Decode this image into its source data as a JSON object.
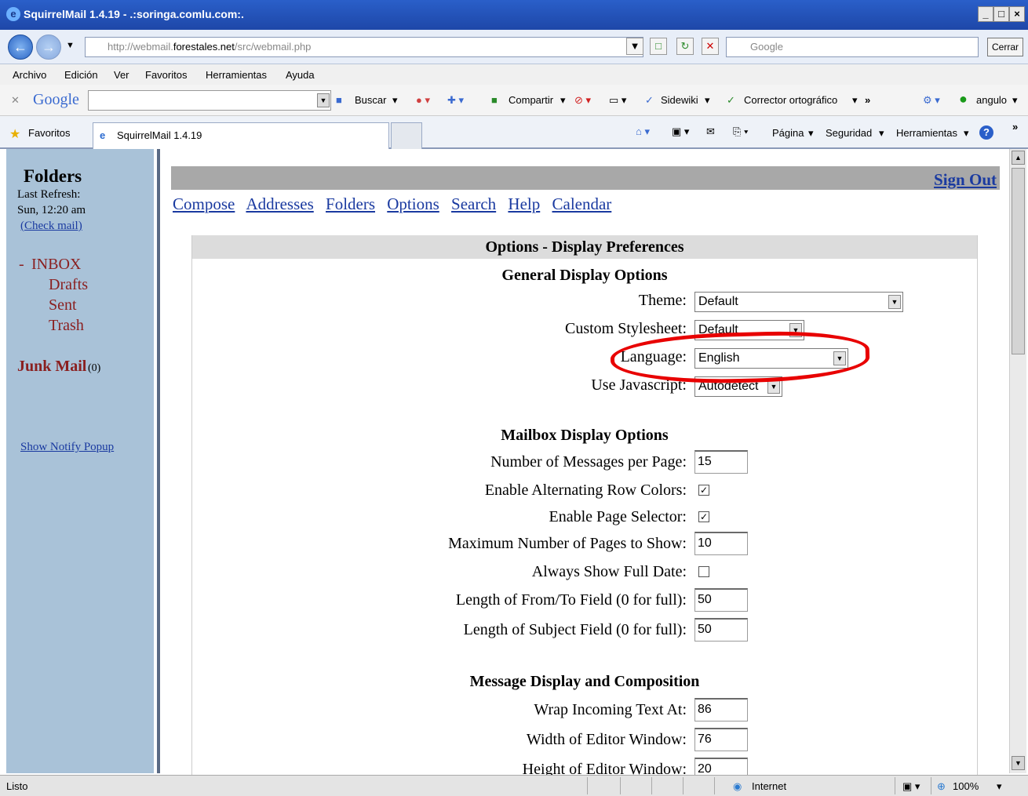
{
  "window": {
    "title": "SquirrelMail 1.4.19 - .:soringa.comlu.com:.",
    "minimize": "_",
    "maximize": "×"
  },
  "addressbar": {
    "url_prefix": "http://webmail.",
    "url_domain": "forestales.net",
    "url_path": "/src/webmail.php",
    "search_placeholder": "Google",
    "close_label": "Cerrar"
  },
  "menubar": {
    "items": [
      "Archivo",
      "Edición",
      "Ver",
      "Favoritos",
      "Herramientas",
      "Ayuda"
    ]
  },
  "google_toolbar": {
    "logo": "Google",
    "buscar": "Buscar",
    "compartir": "Compartir",
    "sidewiki": "Sidewiki",
    "corrector": "Corrector ortográfico",
    "user": "angulo"
  },
  "favbar": {
    "favoritos": "Favoritos",
    "tab_title": "SquirrelMail 1.4.19",
    "pagina": "Página",
    "seguridad": "Seguridad",
    "herramientas": "Herramientas"
  },
  "sidebar": {
    "heading": "Folders",
    "last_refresh_label": "Last Refresh:",
    "last_refresh_time": "Sun, 12:20 am",
    "check_mail": "(Check mail)",
    "collapse": "-",
    "inbox": "INBOX",
    "drafts": "Drafts",
    "sent": "Sent",
    "trash": "Trash",
    "junk": "Junk Mail",
    "junk_count": "(0)",
    "notify": "Show Notify Popup"
  },
  "nav": {
    "sign_out": "Sign Out",
    "links": [
      "Compose",
      "Addresses",
      "Folders",
      "Options",
      "Search",
      "Help",
      "Calendar"
    ]
  },
  "options": {
    "header": "Options - Display Preferences",
    "general": {
      "heading": "General Display Options",
      "theme_label": "Theme:",
      "theme_value": "Default",
      "stylesheet_label": "Custom Stylesheet:",
      "stylesheet_value": "Default",
      "language_label": "Language:",
      "language_value": "English",
      "javascript_label": "Use Javascript:",
      "javascript_value": "Autodetect"
    },
    "mailbox": {
      "heading": "Mailbox Display Options",
      "msgs_per_page_label": "Number of Messages per Page:",
      "msgs_per_page": "15",
      "alt_rows_label": "Enable Alternating Row Colors:",
      "alt_rows_checked": true,
      "page_selector_label": "Enable Page Selector:",
      "page_selector_checked": true,
      "max_pages_label": "Maximum Number of Pages to Show:",
      "max_pages": "10",
      "full_date_label": "Always Show Full Date:",
      "full_date_checked": false,
      "from_len_label": "Length of From/To Field (0 for full):",
      "from_len": "50",
      "subject_len_label": "Length of Subject Field (0 for full):",
      "subject_len": "50"
    },
    "message": {
      "heading": "Message Display and Composition",
      "wrap_label": "Wrap Incoming Text At:",
      "wrap": "86",
      "editor_width_label": "Width of Editor Window:",
      "editor_width": "76",
      "editor_height_label": "Height of Editor Window:",
      "editor_height": "20"
    }
  },
  "statusbar": {
    "status": "Listo",
    "zone": "Internet",
    "zoom": "100%"
  },
  "colors": {
    "titlebar": "#1e47a8",
    "sidebar": "#a9c2d8",
    "link": "#1a3aa0",
    "folder": "#8a1f1f",
    "annotation": "#e80000"
  }
}
